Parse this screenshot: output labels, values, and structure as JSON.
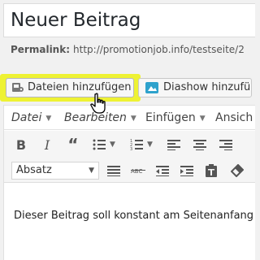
{
  "post": {
    "title": "Neuer Beitrag",
    "permalink_label": "Permalink:",
    "permalink_url": "http://promotionjob.info/testseite/2"
  },
  "media_buttons": {
    "add_media_label": "Dateien hinzufügen",
    "slideshow_label": "Diashow hinzufü"
  },
  "editor": {
    "menubar": [
      "Datei",
      "Bearbeiten",
      "Einfügen",
      "Ansich"
    ],
    "format_select": "Absatz",
    "content_text": "Dieser Beitrag soll konstant am Seitenanfang"
  },
  "colors": {
    "highlight": "#eef233",
    "slideshow_icon": "#2ea2cc"
  }
}
